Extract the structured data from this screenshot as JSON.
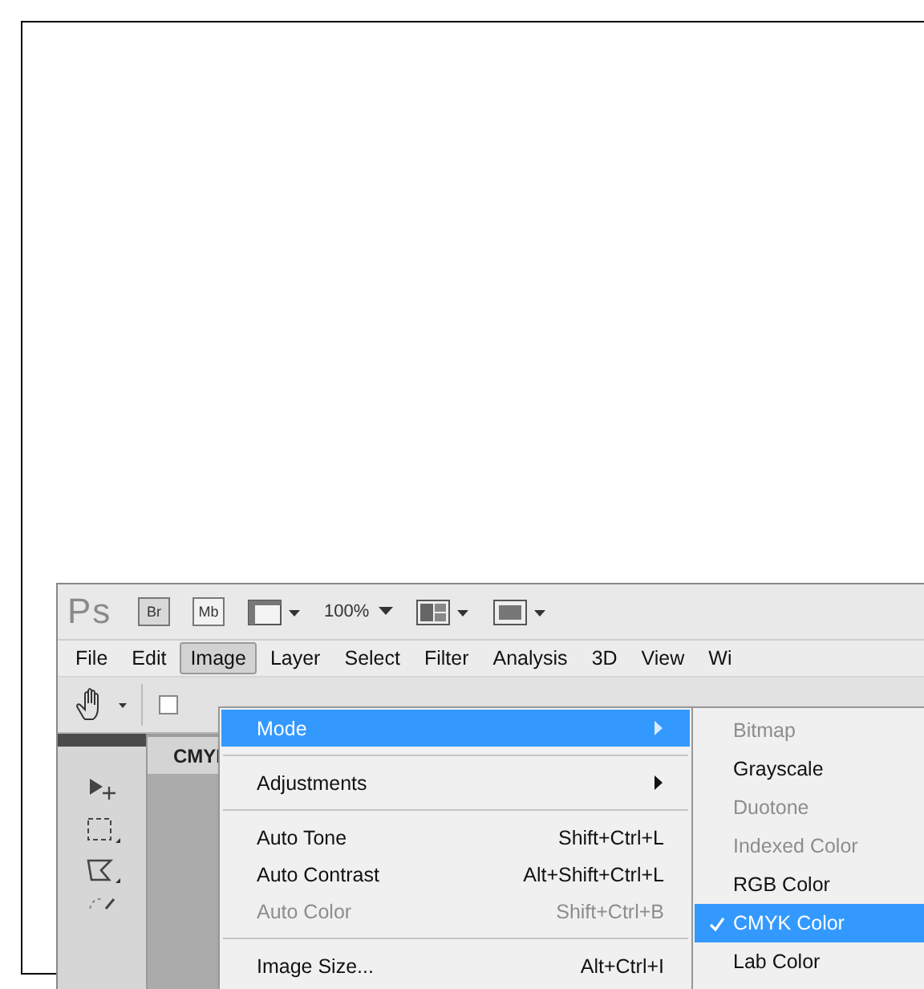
{
  "app_bar": {
    "logo": "Ps",
    "bridge": "Br",
    "mini_bridge": "Mb",
    "zoom": "100%"
  },
  "menu_bar": [
    {
      "label": "File",
      "selected": false
    },
    {
      "label": "Edit",
      "selected": false
    },
    {
      "label": "Image",
      "selected": true
    },
    {
      "label": "Layer",
      "selected": false
    },
    {
      "label": "Select",
      "selected": false
    },
    {
      "label": "Filter",
      "selected": false
    },
    {
      "label": "Analysis",
      "selected": false
    },
    {
      "label": "3D",
      "selected": false
    },
    {
      "label": "View",
      "selected": false
    },
    {
      "label": "Wi",
      "selected": false
    }
  ],
  "options_bar": {
    "checkbox_checked": false
  },
  "document_tab": {
    "title": "CMYI"
  },
  "image_menu": {
    "items": [
      {
        "kind": "item",
        "label": "Mode",
        "submenu": true,
        "selected": true,
        "disabled": false
      },
      {
        "kind": "separator"
      },
      {
        "kind": "item",
        "label": "Adjustments",
        "submenu": true,
        "selected": false,
        "disabled": false
      },
      {
        "kind": "separator"
      },
      {
        "kind": "item",
        "label": "Auto Tone",
        "shortcut": "Shift+Ctrl+L",
        "selected": false,
        "disabled": false
      },
      {
        "kind": "item",
        "label": "Auto Contrast",
        "shortcut": "Alt+Shift+Ctrl+L",
        "selected": false,
        "disabled": false
      },
      {
        "kind": "item",
        "label": "Auto Color",
        "shortcut": "Shift+Ctrl+B",
        "selected": false,
        "disabled": true
      },
      {
        "kind": "separator"
      },
      {
        "kind": "item",
        "label": "Image Size...",
        "shortcut": "Alt+Ctrl+I",
        "selected": false,
        "disabled": false
      }
    ]
  },
  "mode_submenu": {
    "items": [
      {
        "label": "Bitmap",
        "disabled": true,
        "checked": false,
        "selected": false
      },
      {
        "label": "Grayscale",
        "disabled": false,
        "checked": false,
        "selected": false
      },
      {
        "label": "Duotone",
        "disabled": true,
        "checked": false,
        "selected": false
      },
      {
        "label": "Indexed Color",
        "disabled": true,
        "checked": false,
        "selected": false
      },
      {
        "label": "RGB Color",
        "disabled": false,
        "checked": false,
        "selected": false
      },
      {
        "label": "CMYK Color",
        "disabled": false,
        "checked": true,
        "selected": true
      },
      {
        "label": "Lab Color",
        "disabled": false,
        "checked": false,
        "selected": false
      }
    ]
  }
}
